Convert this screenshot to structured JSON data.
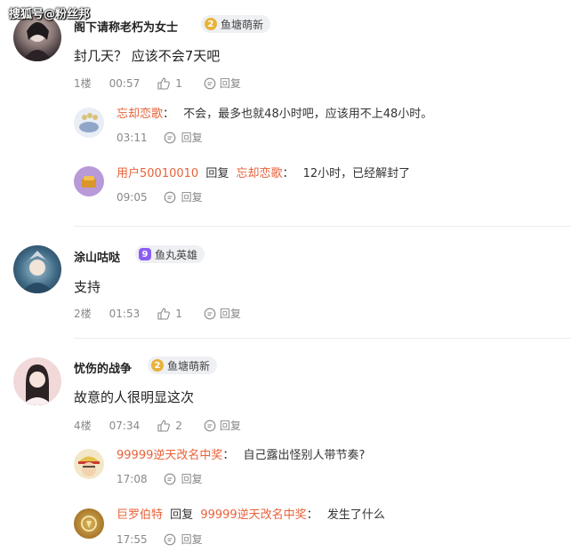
{
  "watermark": "搜狐号@粉丝邦",
  "comments": [
    {
      "username": "阁下请称老朽为女士",
      "badge": {
        "level": "2",
        "label": "鱼塘萌新",
        "color": "#e8b23a"
      },
      "text": "封几天？ 应该不会7天吧",
      "floor": "1楼",
      "time": "00:57",
      "likes": "1",
      "reply_label": "回复",
      "replies": [
        {
          "name": "忘却恋歌",
          "sep": "：",
          "text": "不会，最多也就48小时吧，应该用不上48小时。",
          "time": "03:11",
          "reply_label": "回复"
        },
        {
          "name": "用户50010010",
          "reply_word": "回复",
          "target": "忘却恋歌",
          "sep": "：",
          "text": "12小时，已经解封了",
          "time": "09:05",
          "reply_label": "回复"
        }
      ]
    },
    {
      "username": "涂山咕哒",
      "badge": {
        "level": "9",
        "label": "鱼丸英雄",
        "color": "#8b5cf6"
      },
      "text": "支持",
      "floor": "2楼",
      "time": "01:53",
      "likes": "1",
      "reply_label": "回复"
    },
    {
      "username": "忧伤的战争",
      "badge": {
        "level": "2",
        "label": "鱼塘萌新",
        "color": "#e8b23a"
      },
      "text": "故意的人很明显这次",
      "floor": "4楼",
      "time": "07:34",
      "likes": "2",
      "reply_label": "回复",
      "replies": [
        {
          "name": "99999逆天改名中奖",
          "sep": "：",
          "text": "自己露出怪别人带节奏?",
          "time": "17:08",
          "reply_label": "回复"
        },
        {
          "name": "巨罗伯特",
          "reply_word": "回复",
          "target": "99999逆天改名中奖",
          "sep": "：",
          "text": "发生了什么",
          "time": "17:55",
          "reply_label": "回复"
        }
      ]
    }
  ],
  "colors": {
    "reply_name": "#e8623a",
    "meta": "#888888",
    "divider": "#ececec"
  }
}
